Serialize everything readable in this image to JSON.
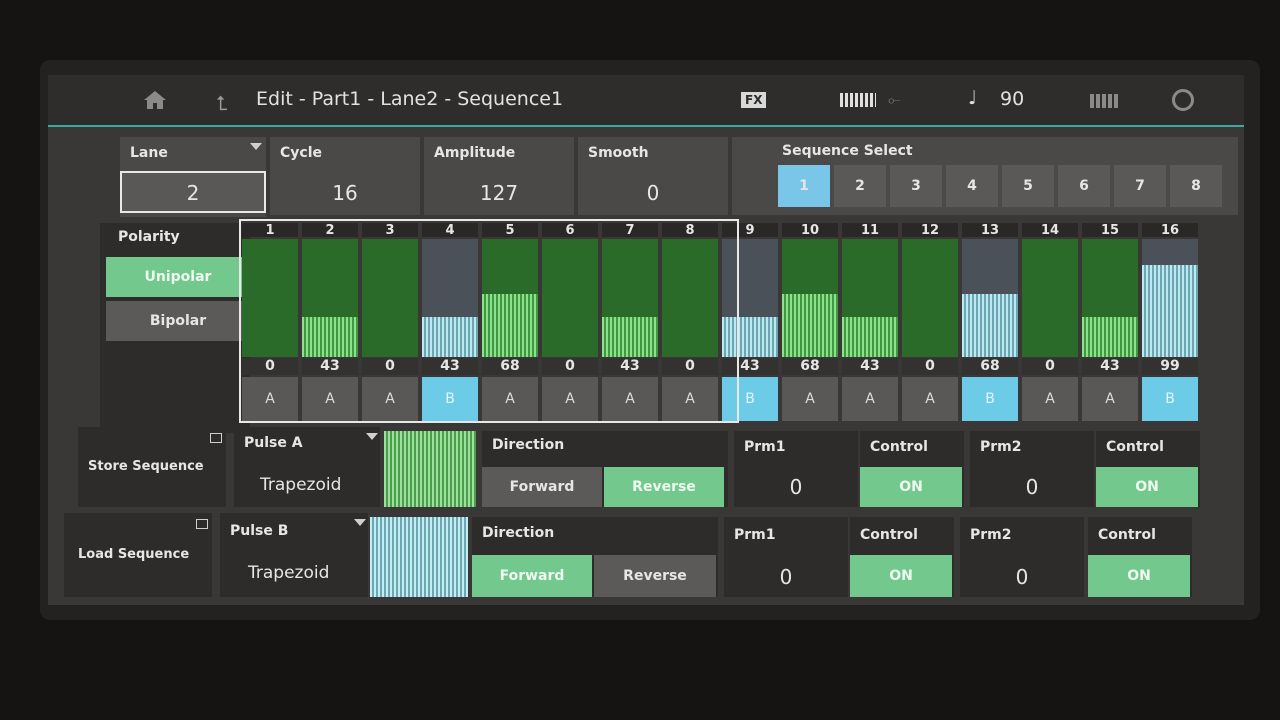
{
  "header": {
    "title": "Edit - Part1 - Lane2 - Sequence1",
    "fx_label": "FX",
    "tempo": "90",
    "note_glyph": "♩",
    "icons": [
      "home-icon",
      "back-icon",
      "keyboard-icon",
      "usb-icon",
      "grid-icon",
      "gear-icon"
    ]
  },
  "lane": {
    "label": "Lane",
    "value": "2"
  },
  "cycle": {
    "label": "Cycle",
    "value": "16"
  },
  "amplitude": {
    "label": "Amplitude",
    "value": "127"
  },
  "smooth": {
    "label": "Smooth",
    "value": "0"
  },
  "sequence_select": {
    "label": "Sequence Select",
    "items": [
      "1",
      "2",
      "3",
      "4",
      "5",
      "6",
      "7",
      "8"
    ],
    "selected": "1"
  },
  "polarity": {
    "label": "Polarity",
    "options": [
      "Unipolar",
      "Bipolar"
    ],
    "selected": "Unipolar"
  },
  "steps": [
    {
      "num": "1",
      "value": "0",
      "pulse": "A"
    },
    {
      "num": "2",
      "value": "43",
      "pulse": "A"
    },
    {
      "num": "3",
      "value": "0",
      "pulse": "A"
    },
    {
      "num": "4",
      "value": "43",
      "pulse": "B"
    },
    {
      "num": "5",
      "value": "68",
      "pulse": "A"
    },
    {
      "num": "6",
      "value": "0",
      "pulse": "A"
    },
    {
      "num": "7",
      "value": "43",
      "pulse": "A"
    },
    {
      "num": "8",
      "value": "0",
      "pulse": "A"
    },
    {
      "num": "9",
      "value": "43",
      "pulse": "B"
    },
    {
      "num": "10",
      "value": "68",
      "pulse": "A"
    },
    {
      "num": "11",
      "value": "43",
      "pulse": "A"
    },
    {
      "num": "12",
      "value": "0",
      "pulse": "A"
    },
    {
      "num": "13",
      "value": "68",
      "pulse": "B"
    },
    {
      "num": "14",
      "value": "0",
      "pulse": "A"
    },
    {
      "num": "15",
      "value": "43",
      "pulse": "A"
    },
    {
      "num": "16",
      "value": "99",
      "pulse": "B"
    }
  ],
  "step_max": 127,
  "store_sequence": "Store Sequence",
  "load_sequence": "Load Sequence",
  "pulse_a": {
    "label": "Pulse A",
    "shape": "Trapezoid",
    "direction_label": "Direction",
    "directions": [
      "Forward",
      "Reverse"
    ],
    "direction_selected": "Reverse",
    "prm1_label": "Prm1",
    "prm1": "0",
    "control1_label": "Control",
    "control1": "ON",
    "prm2_label": "Prm2",
    "prm2": "0",
    "control2_label": "Control",
    "control2": "ON"
  },
  "pulse_b": {
    "label": "Pulse B",
    "shape": "Trapezoid",
    "direction_label": "Direction",
    "directions": [
      "Forward",
      "Reverse"
    ],
    "direction_selected": "Forward",
    "prm1_label": "Prm1",
    "prm1": "0",
    "control1_label": "Control",
    "control1": "ON",
    "prm2_label": "Prm2",
    "prm2": "0",
    "control2_label": "Control",
    "control2": "ON"
  },
  "colors": {
    "accent": "#3fa8a0",
    "on_green": "#73c88e",
    "pulse_b_blue": "#79c6e8"
  }
}
